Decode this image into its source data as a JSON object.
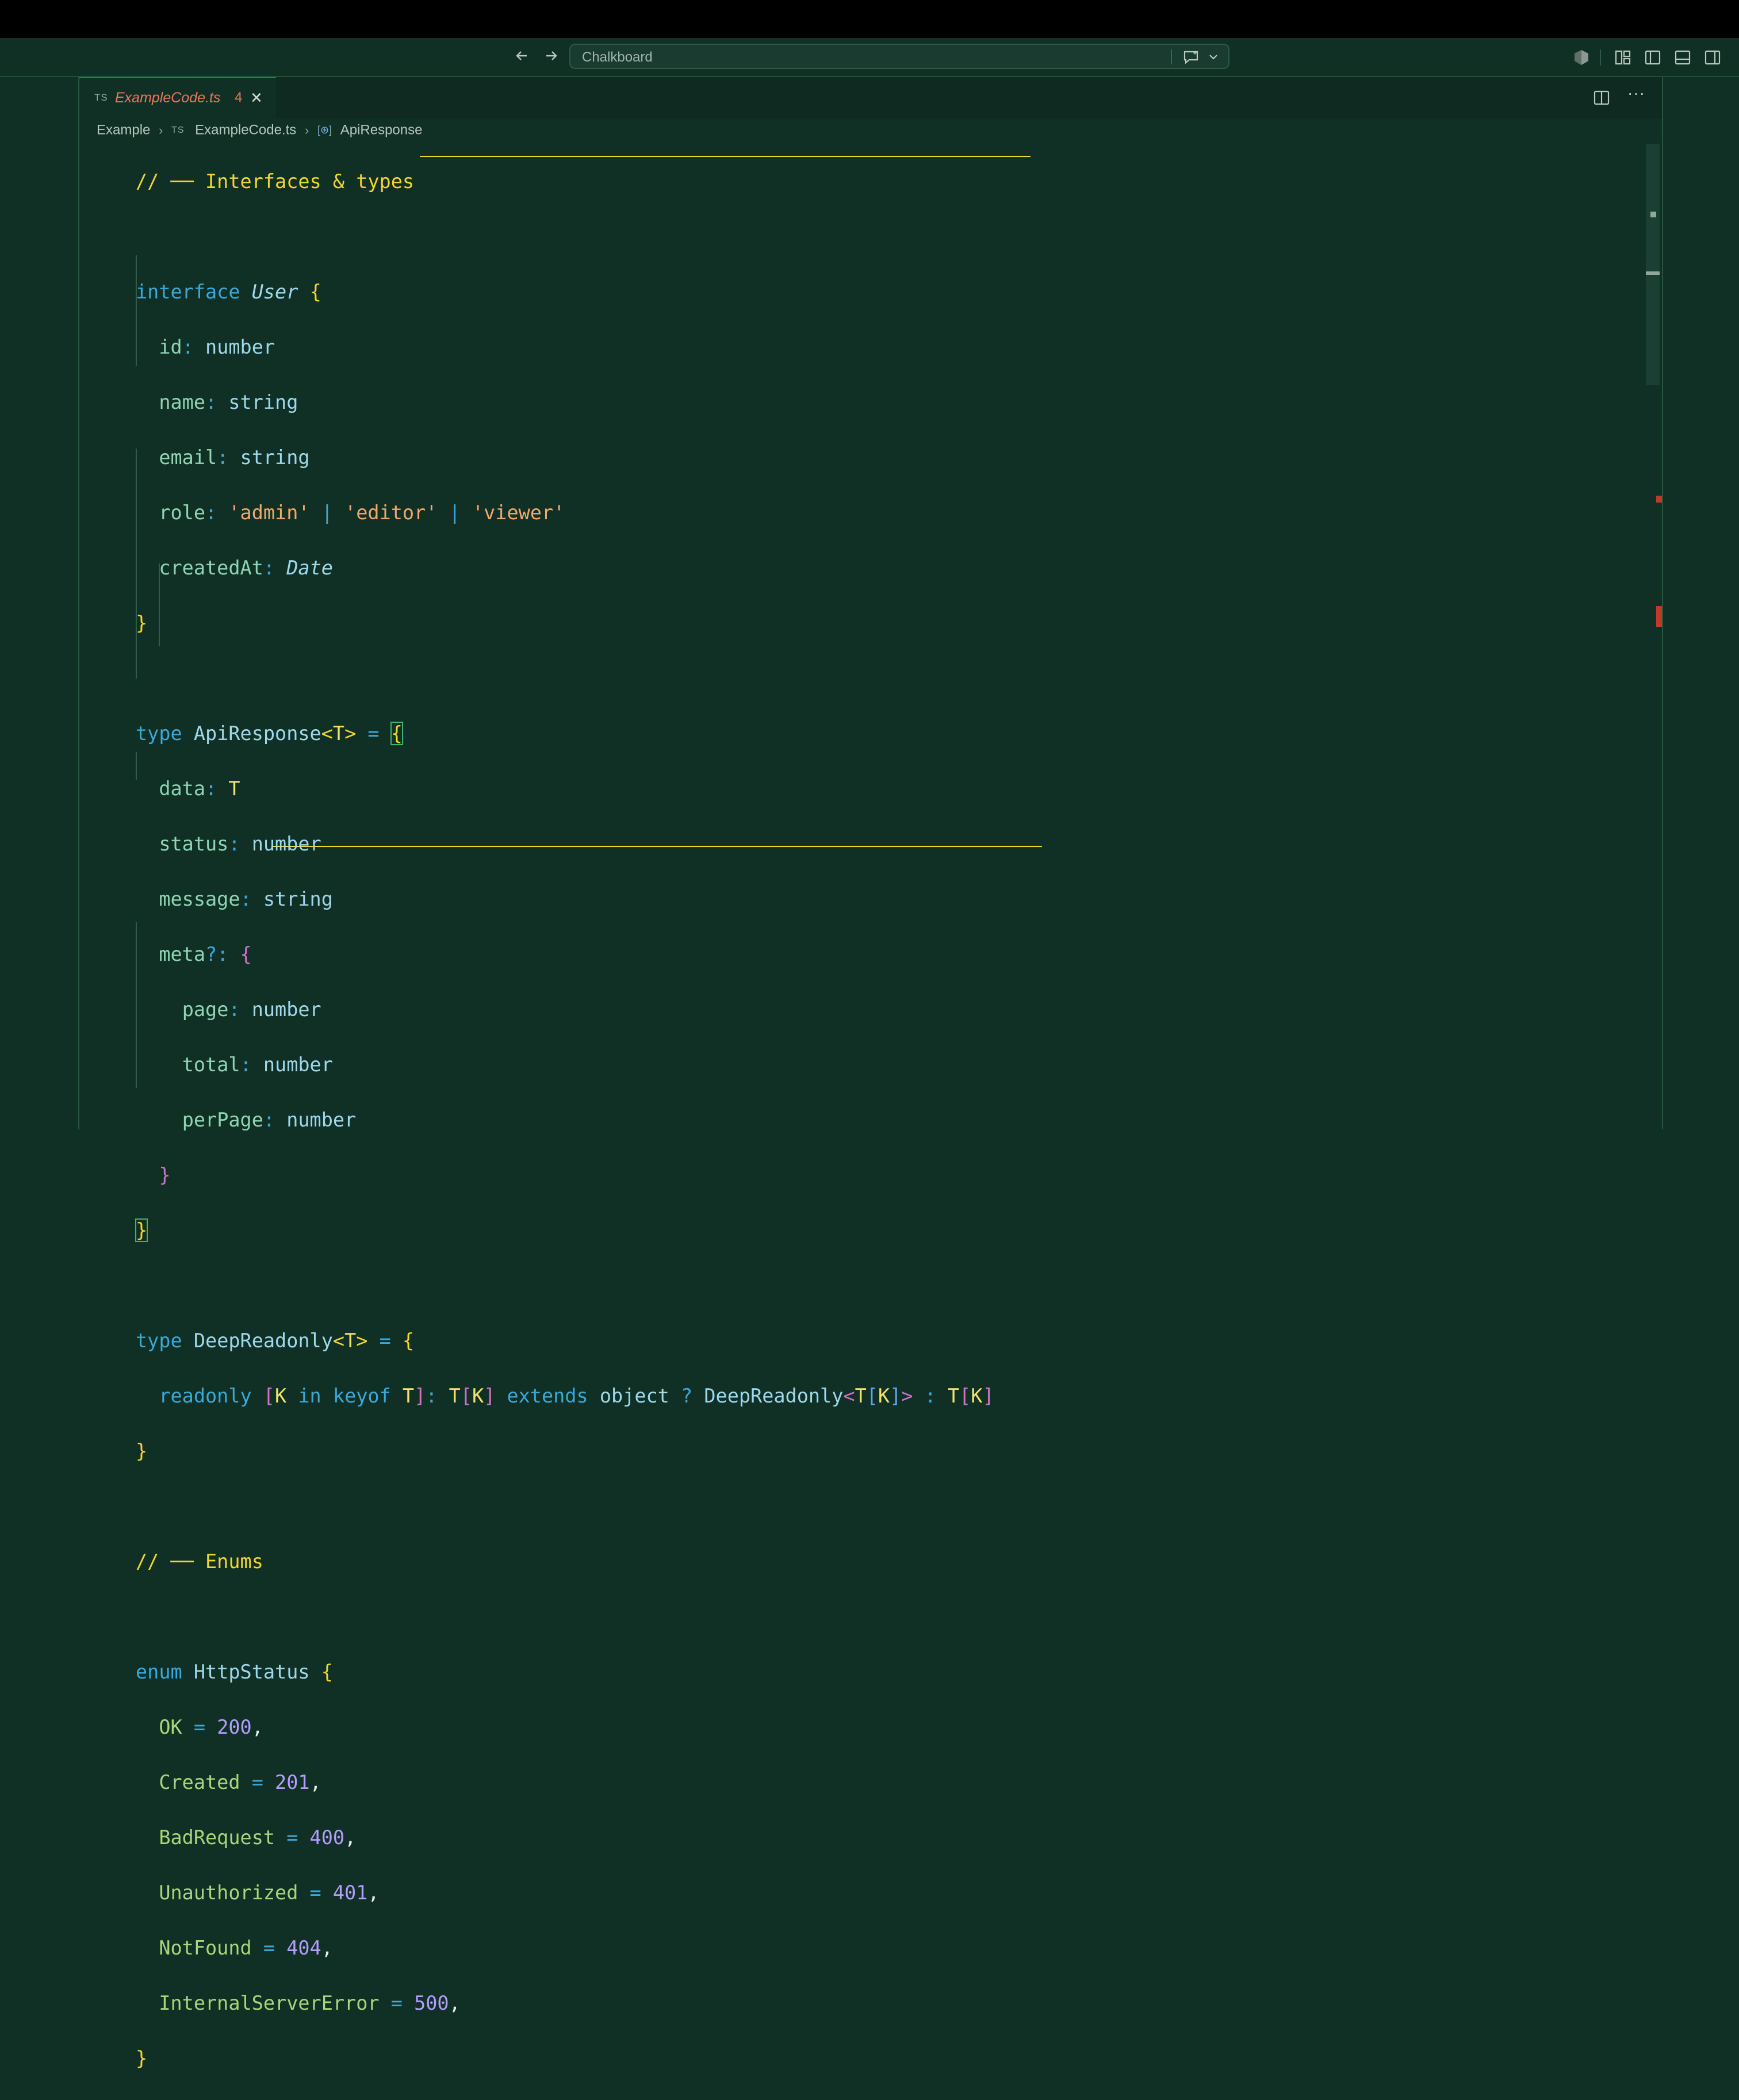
{
  "titlebar": {
    "back_icon": "arrow-left-icon",
    "forward_icon": "arrow-right-icon",
    "search_text": "Chalkboard",
    "copilot_icon": "copilot-chat-icon",
    "layout_icons": [
      "accounts-shield-icon",
      "customize-layout-icon",
      "toggle-primary-sidebar-icon",
      "toggle-panel-icon",
      "toggle-secondary-sidebar-icon"
    ]
  },
  "tab": {
    "lang": "TS",
    "filename": "ExampleCode.ts",
    "problems": "4",
    "close": "×"
  },
  "editor_actions": {
    "split_icon": "split-editor-icon",
    "more": "···"
  },
  "breadcrumb": {
    "folder": "Example",
    "file_lang": "TS",
    "file": "ExampleCode.ts",
    "symbol": "ApiResponse"
  },
  "code": {
    "c1_prefix": "// ── ",
    "c1_title": "Interfaces & types",
    "user_kw": "interface",
    "user_name": "User",
    "p_id": "id",
    "t_number": "number",
    "p_name": "name",
    "t_string": "string",
    "p_email": "email",
    "p_role": "role",
    "s_admin": "'admin'",
    "s_editor": "'editor'",
    "s_viewer": "'viewer'",
    "p_createdAt": "createdAt",
    "t_date": "Date",
    "type_kw": "type",
    "api_name": "ApiResponse",
    "tparam": "T",
    "p_data": "data",
    "p_status": "status",
    "p_message": "message",
    "p_meta": "meta",
    "p_page": "page",
    "p_total": "total",
    "p_perPage": "perPage",
    "dr_name": "DeepReadonly",
    "readonly_kw": "readonly",
    "k_param": "K",
    "in_kw": "in",
    "keyof_kw": "keyof",
    "extends_kw": "extends",
    "object_kw": "object",
    "c2_prefix": "// ── ",
    "c2_title": "Enums",
    "enum_kw": "enum",
    "enum_name": "HttpStatus",
    "enum_members": [
      {
        "name": "OK",
        "value": "200"
      },
      {
        "name": "Created",
        "value": "201"
      },
      {
        "name": "BadRequest",
        "value": "400"
      },
      {
        "name": "Unauthorized",
        "value": "401"
      },
      {
        "name": "NotFound",
        "value": "404"
      },
      {
        "name": "InternalServerError",
        "value": "500"
      }
    ]
  },
  "colors": {
    "background": "#103026",
    "keyword": "#3aa8d8",
    "comment": "#f1d62c",
    "string": "#f3a86b",
    "number": "#b59cff",
    "error": "#c03a2b"
  }
}
